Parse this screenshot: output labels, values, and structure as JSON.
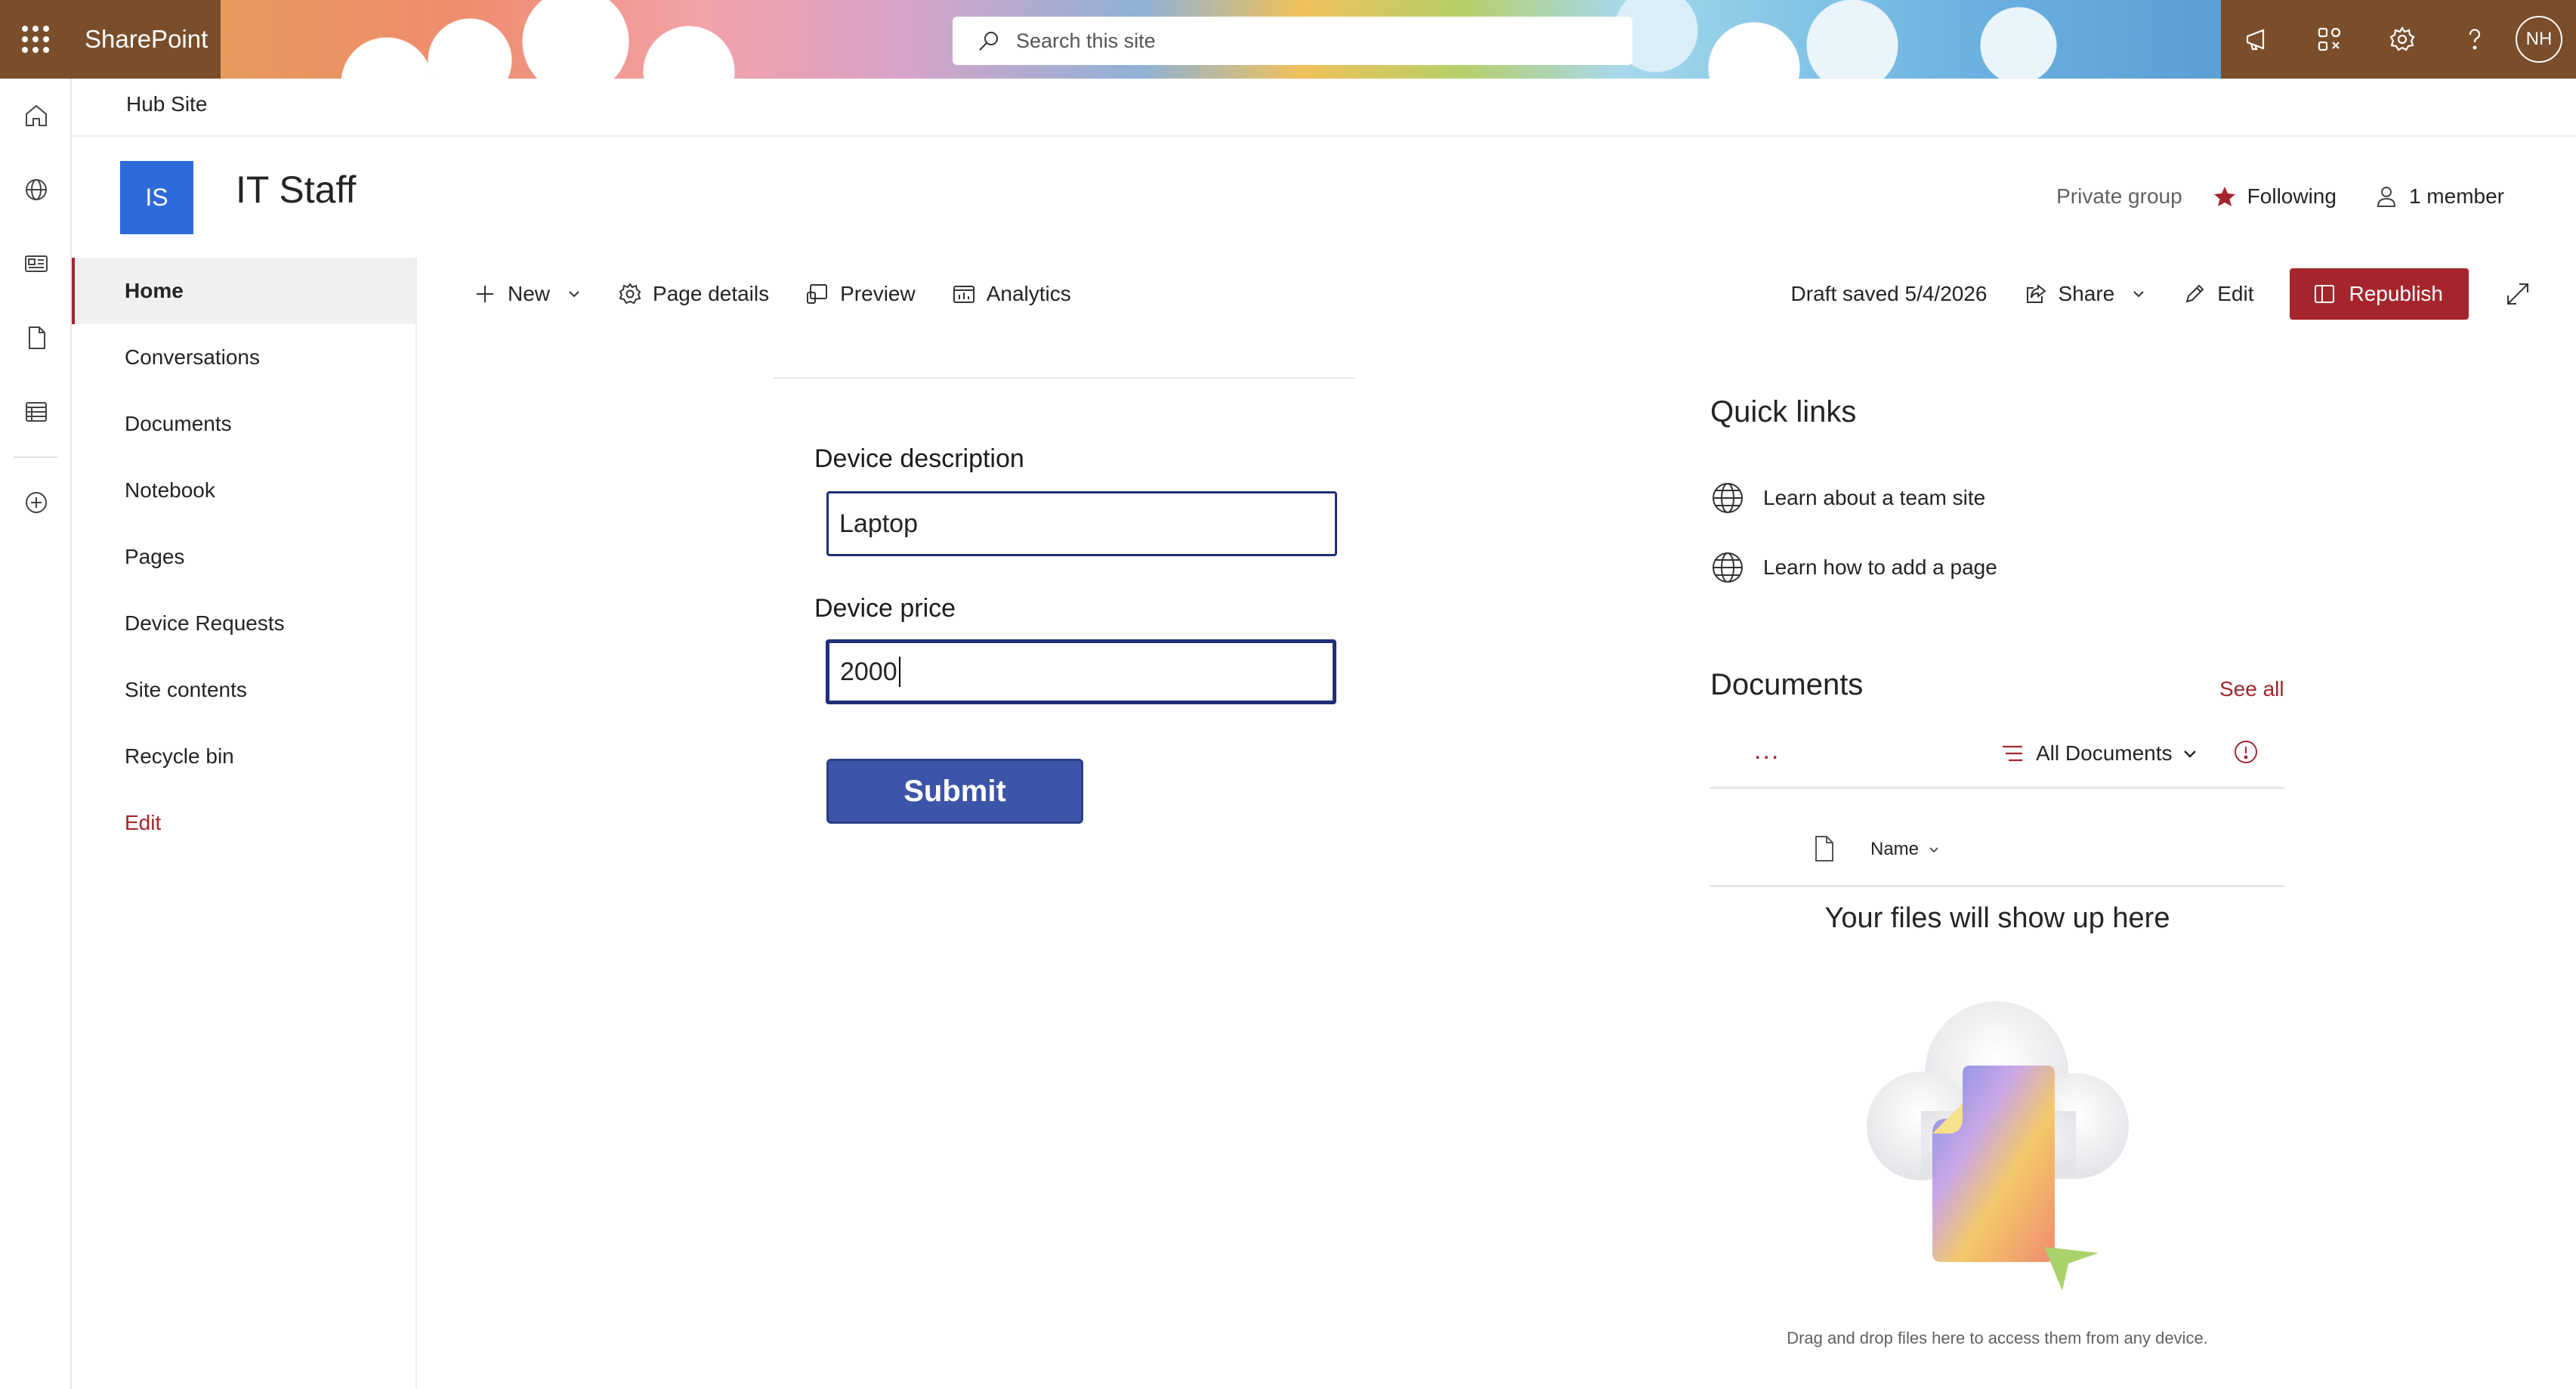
{
  "suite_bar": {
    "app_name": "SharePoint",
    "search_placeholder": "Search this site",
    "avatar_initials": "NH"
  },
  "hub": {
    "name": "Hub Site"
  },
  "site": {
    "logo_initials": "IS",
    "title": "IT Staff",
    "privacy": "Private group",
    "following_label": "Following",
    "members_label": "1 member"
  },
  "left_nav": {
    "items": [
      {
        "label": "Home"
      },
      {
        "label": "Conversations"
      },
      {
        "label": "Documents"
      },
      {
        "label": "Notebook"
      },
      {
        "label": "Pages"
      },
      {
        "label": "Device Requests"
      },
      {
        "label": "Site contents"
      },
      {
        "label": "Recycle bin"
      },
      {
        "label": "Edit"
      }
    ]
  },
  "command_bar": {
    "new_label": "New",
    "page_details_label": "Page details",
    "preview_label": "Preview",
    "analytics_label": "Analytics",
    "draft_status": "Draft saved 5/4/2026",
    "share_label": "Share",
    "edit_label": "Edit",
    "republish_label": "Republish"
  },
  "form": {
    "description_label": "Device description",
    "description_value": "Laptop",
    "price_label": "Device price",
    "price_value": "2000",
    "submit_label": "Submit"
  },
  "quick_links": {
    "title": "Quick links",
    "items": [
      {
        "label": "Learn about a team site"
      },
      {
        "label": "Learn how to add a page"
      }
    ]
  },
  "documents": {
    "title": "Documents",
    "see_all": "See all",
    "more_label": "...",
    "view_label": "All Documents",
    "name_column": "Name",
    "empty_title": "Your files will show up here",
    "empty_subtitle": "Drag and drop files here to access them from any device."
  },
  "colors": {
    "accent": "#a4262c",
    "suite_bar": "#7a4e2b",
    "site_logo": "#2d6bdb",
    "submit_button": "#3c55a8",
    "field_border": "#1f3079"
  }
}
